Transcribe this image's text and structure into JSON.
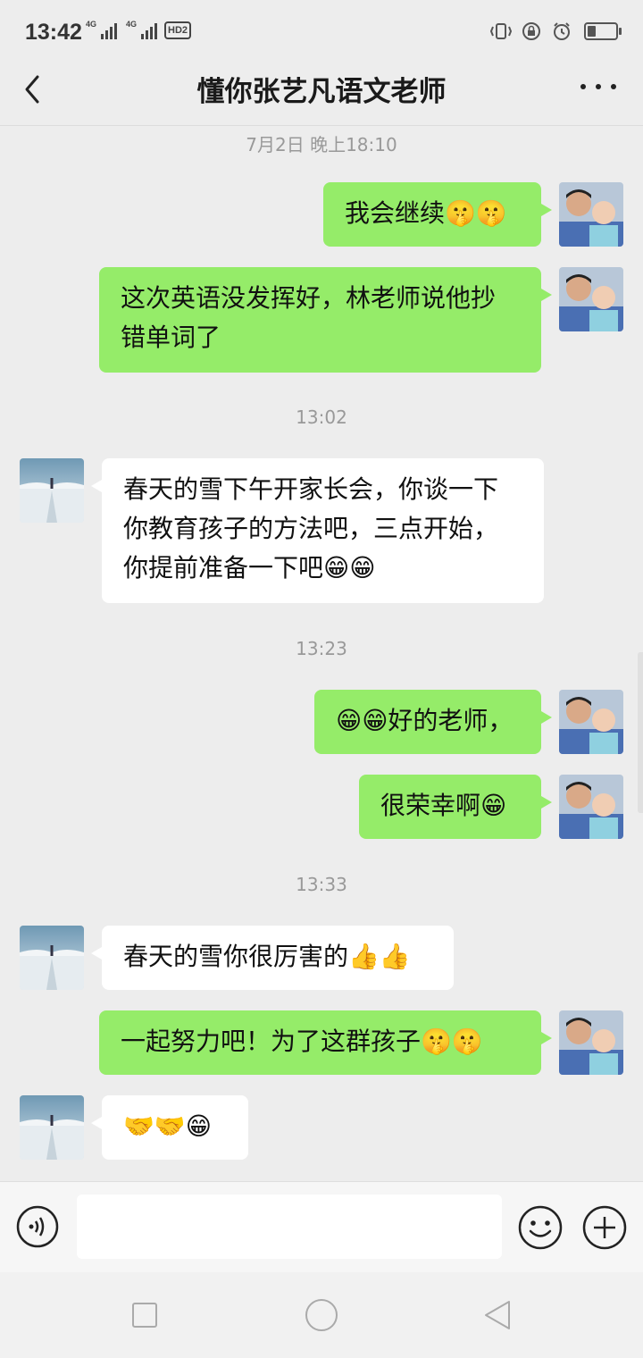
{
  "status_bar": {
    "time": "13:42",
    "net1": "4G",
    "net2": "4G",
    "hd": "HD2"
  },
  "header": {
    "title": "懂你张艺凡语文老师"
  },
  "messages": {
    "ts1": "7月2日 晚上18:10",
    "m1": "我会继续🤫🤫",
    "m2": "这次英语没发挥好，林老师说他抄错单词了",
    "ts2": "13:02",
    "m3": "春天的雪下午开家长会，你谈一下你教育孩子的方法吧，三点开始，你提前准备一下吧😁😁",
    "ts3": "13:23",
    "m4": "😁😁好的老师，",
    "m5": "很荣幸啊😁",
    "ts4": "13:33",
    "m6": "春天的雪你很厉害的👍👍",
    "m7": "一起努力吧！为了这群孩子🤫🤫",
    "m8": "🤝🤝😁"
  },
  "input": {
    "placeholder": ""
  },
  "icons": {
    "back": "chevron-left-icon",
    "more": "more-dots-icon",
    "voice": "voice-icon",
    "emoji": "emoji-icon",
    "plus": "plus-icon"
  },
  "colors": {
    "my_bubble": "#95ec69",
    "their_bubble": "#ffffff",
    "background": "#ededed"
  },
  "battery_level": 0.3
}
